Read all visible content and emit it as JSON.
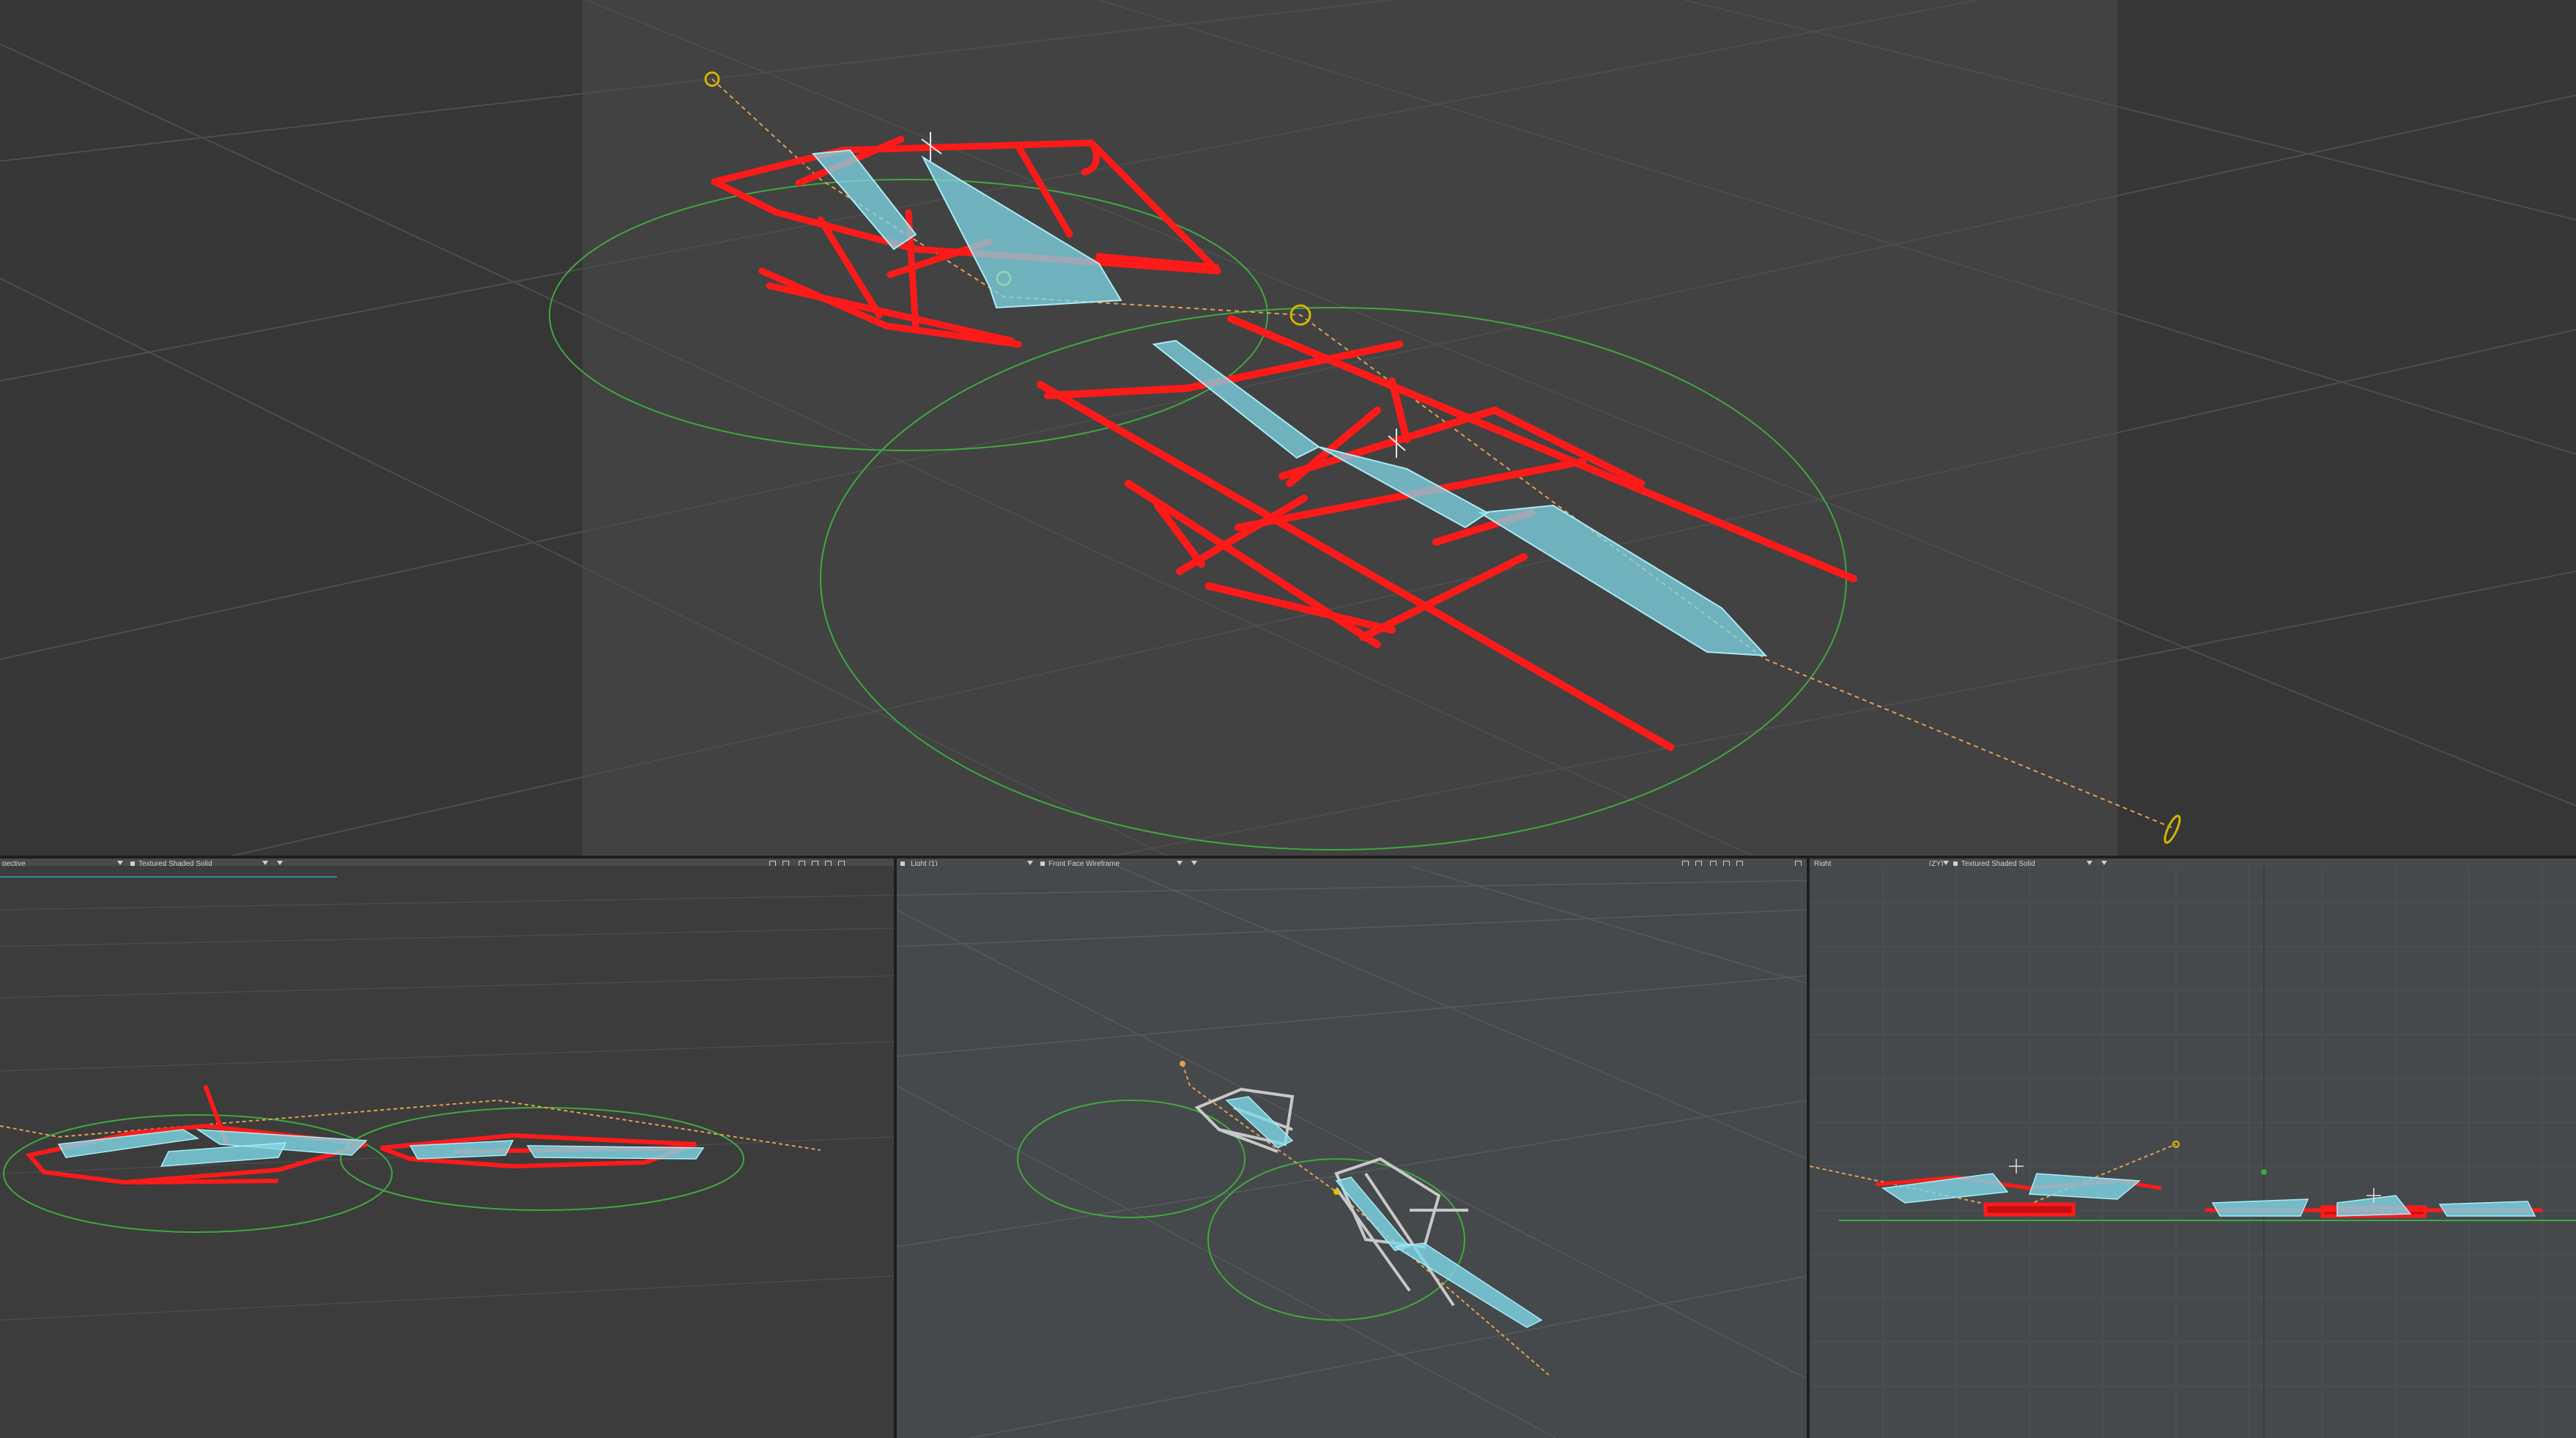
{
  "colors": {
    "rig": "#ff1a1a",
    "bone": "#7fd8e8",
    "range_circle": "#3fa83f",
    "light_path": "#e0a050",
    "wire": "#c8c8c8"
  },
  "viewports": {
    "main": {
      "label": ""
    },
    "perspective": {
      "view_label": "pective",
      "shading_label": "Textured Shaded Solid"
    },
    "light": {
      "view_label": "Light (1)",
      "shading_label": "Front Face Wireframe"
    },
    "right": {
      "view_label": "Right",
      "axis_label": "(ZY)",
      "shading_label": "Textured Shaded Solid"
    }
  },
  "icons": [
    "camera-icon",
    "grid-icon",
    "move-icon",
    "rotate-icon",
    "zoom-icon",
    "maximize-icon"
  ]
}
